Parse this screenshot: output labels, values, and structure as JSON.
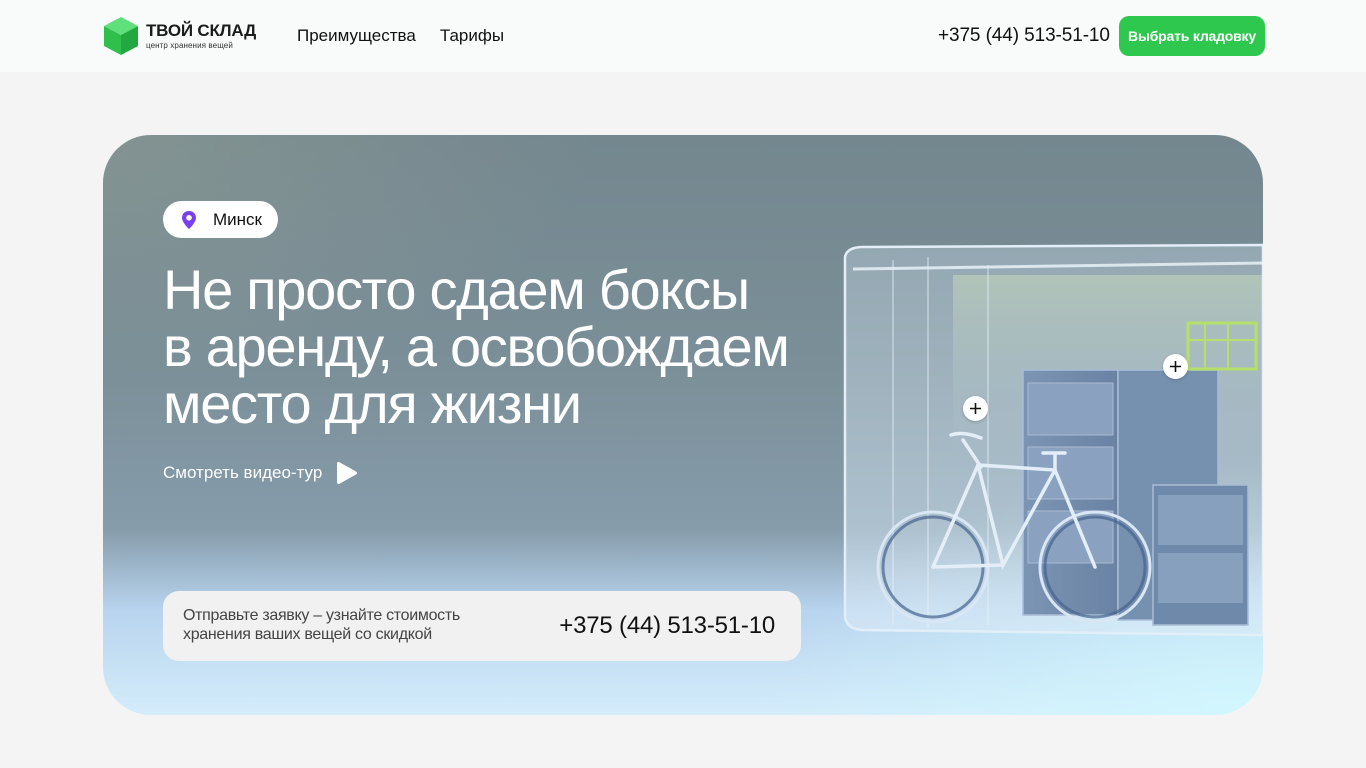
{
  "brand": {
    "name": "ТВОЙ СКЛАД",
    "tagline": "центр хранения вещей",
    "accent": "#2dc84d"
  },
  "nav": {
    "items": [
      "Преимущества",
      "Тарифы"
    ]
  },
  "header": {
    "phone": "+375 (44) 513-51-10",
    "cta_label": "Выбрать кладовку"
  },
  "hero": {
    "city": "Минск",
    "title_lines": [
      "Не просто сдаем боксы",
      "в аренду, а освобождаем",
      "место для жизни"
    ],
    "video_label": "Смотреть видео-тур",
    "callback_text": "Отправьте заявку – узнайте стоимость хранения ваших вещей со скидкой",
    "callback_phone": "+375 (44) 513-51-10"
  },
  "icons": {
    "logo": "green-box-icon",
    "city": "map-pin-icon",
    "video": "play-icon",
    "hotspot": "plus-icon"
  }
}
